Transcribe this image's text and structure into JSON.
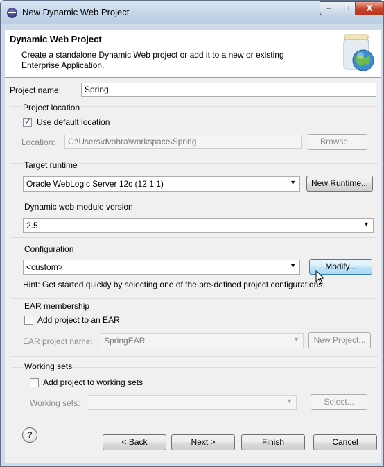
{
  "window": {
    "title": "New Dynamic Web Project",
    "controls": {
      "minimize": "–",
      "maximize": "□",
      "close": "X"
    }
  },
  "banner": {
    "title": "Dynamic Web Project",
    "description": "Create a standalone Dynamic Web project or add it to a new or existing Enterprise Application."
  },
  "project_name": {
    "label": "Project name:",
    "value": "Spring"
  },
  "project_location": {
    "group_label": "Project location",
    "use_default_label": "Use default location",
    "use_default_checked": true,
    "location_label": "Location:",
    "location_value": "C:\\Users\\dvohra\\workspace\\Spring",
    "browse_label": "Browse..."
  },
  "target_runtime": {
    "group_label": "Target runtime",
    "value": "Oracle WebLogic Server 12c (12.1.1)",
    "new_runtime_label": "New Runtime..."
  },
  "module_version": {
    "group_label": "Dynamic web module version",
    "value": "2.5"
  },
  "configuration": {
    "group_label": "Configuration",
    "value": "<custom>",
    "modify_label": "Modify...",
    "hint": "Hint: Get started quickly by selecting one of the pre-defined project configurations."
  },
  "ear": {
    "group_label": "EAR membership",
    "add_label": "Add project to an EAR",
    "add_checked": false,
    "name_label": "EAR project name:",
    "name_value": "SpringEAR",
    "new_project_label": "New Project..."
  },
  "working_sets": {
    "group_label": "Working sets",
    "add_label": "Add project to working sets",
    "add_checked": false,
    "sets_label": "Working sets:",
    "sets_value": "",
    "select_label": "Select..."
  },
  "footer": {
    "help": "?",
    "back_label": "< Back",
    "next_label": "Next >",
    "finish_label": "Finish",
    "cancel_label": "Cancel"
  },
  "icons": [
    "app-icon",
    "wizard-banner-icon",
    "checkbox-check-icon",
    "dropdown-arrow-icon",
    "help-icon",
    "mouse-cursor-icon"
  ]
}
